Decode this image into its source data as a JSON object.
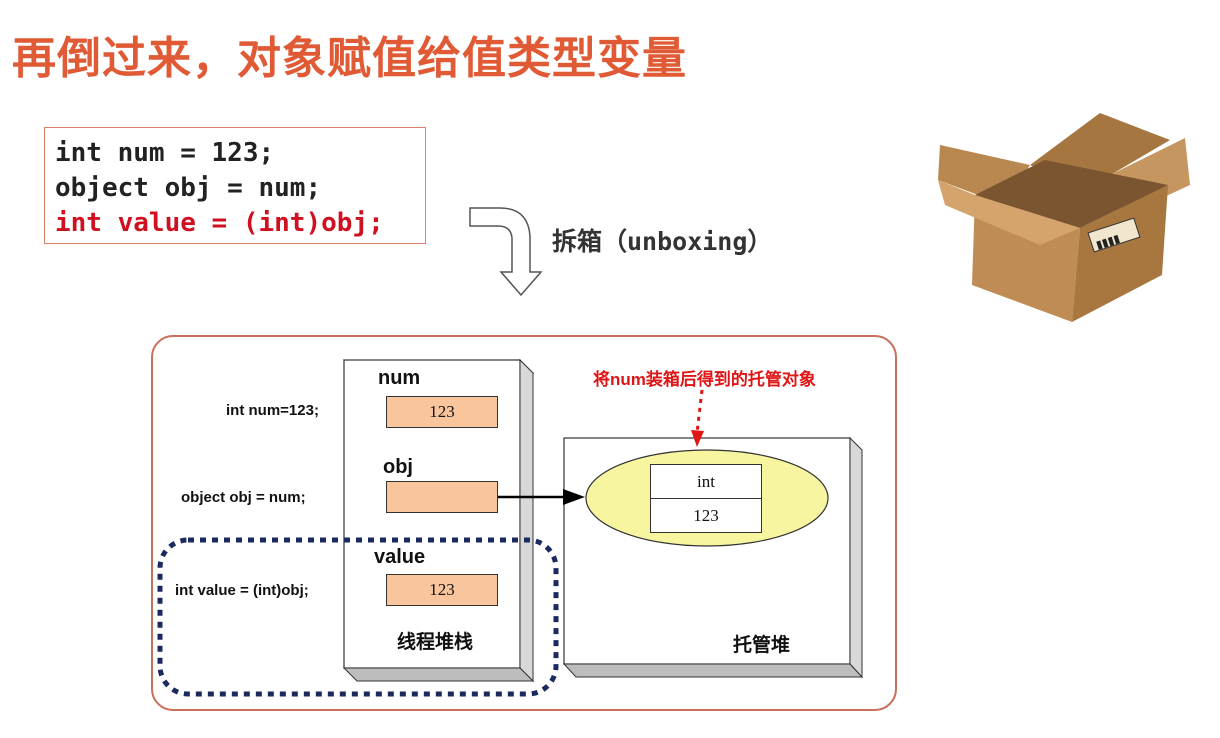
{
  "title": "再倒过来，对象赋值给值类型变量",
  "code": {
    "line1": "int num = 123;",
    "line2": "object obj = num;",
    "line3": "int value = (int)obj;"
  },
  "unboxing_label": "拆箱（unboxing）",
  "diagram": {
    "statements": {
      "num": "int num=123;",
      "obj": "object obj = num;",
      "value": "int value = (int)obj;"
    },
    "stack": {
      "label": "线程堆栈",
      "num_name": "num",
      "num_value": "123",
      "obj_name": "obj",
      "obj_value": "",
      "value_name": "value",
      "value_value": "123"
    },
    "heap": {
      "label": "托管堆",
      "note": "将num装箱后得到的托管对象",
      "type_cell": "int",
      "value_cell": "123"
    }
  },
  "colors": {
    "title": "#e05a35",
    "highlight_code": "#d01020",
    "cell_fill": "#f9c59c",
    "ellipse_fill": "#f7f5a0",
    "dotted_border": "#1a2a5e",
    "note_red": "#e01515"
  },
  "icons": {
    "box": "cardboard-box-icon",
    "arrow": "curved-down-arrow-icon"
  }
}
